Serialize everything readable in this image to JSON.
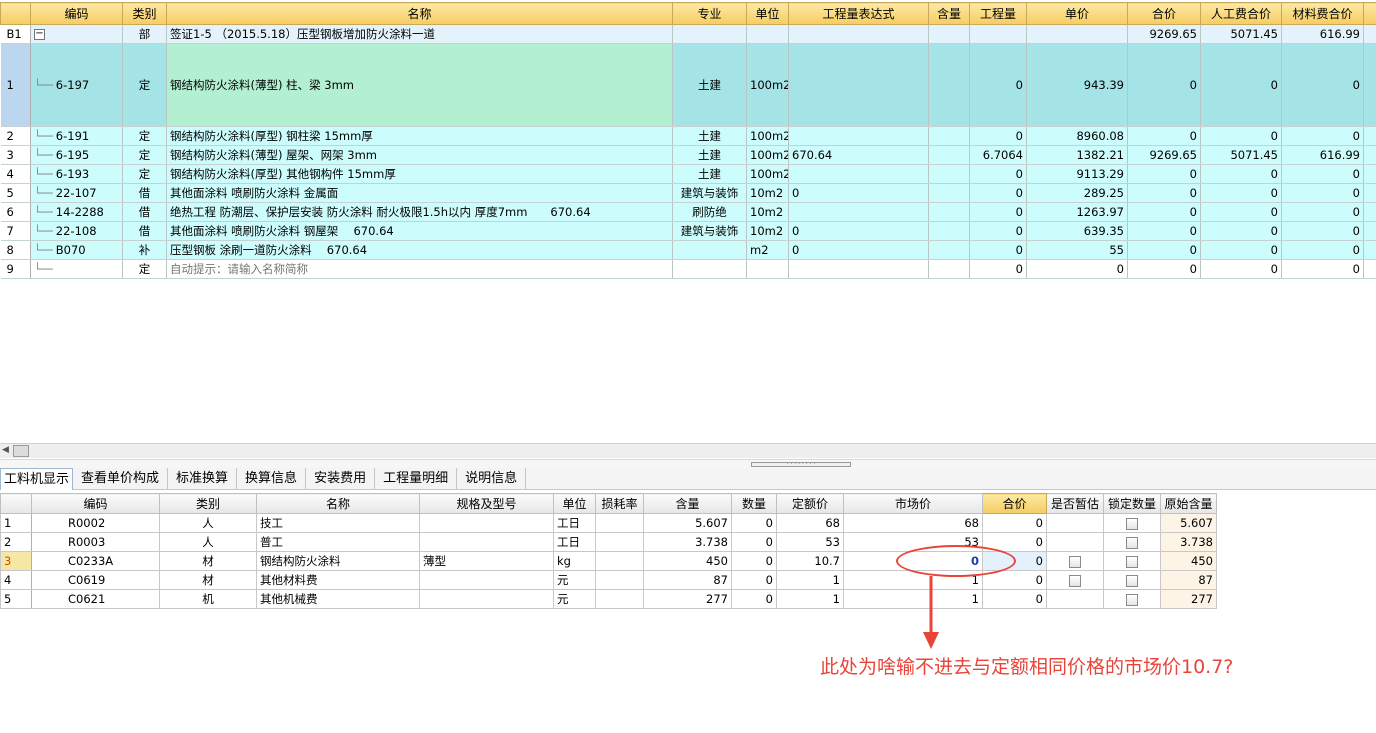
{
  "top_grid": {
    "headers": [
      "",
      "编码",
      "类别",
      "名称",
      "专业",
      "单位",
      "工程量表达式",
      "含量",
      "工程量",
      "单价",
      "合价",
      "人工费合价",
      "材料费合价",
      "材"
    ],
    "section_row": {
      "rownum": "B1",
      "collapse_symbol": "−",
      "type": "部",
      "name": "签证1-5 （2015.5.18）压型钢板增加防火涂料一道",
      "total": "9269.65",
      "labor_total": "5071.45",
      "material_total": "616.99"
    },
    "rows": [
      {
        "rownum": "1",
        "code": "6-197",
        "type": "定",
        "name": "钢结构防火涂料(薄型) 柱、梁 3mm",
        "major": "土建",
        "unit": "100m2",
        "expr": "",
        "qty": "0",
        "price": "943.39",
        "total": "0",
        "labor": "0",
        "material": "0"
      },
      {
        "rownum": "2",
        "code": "6-191",
        "type": "定",
        "name": "钢结构防火涂料(厚型) 钢柱梁 15mm厚",
        "major": "土建",
        "unit": "100m2",
        "expr": "",
        "qty": "0",
        "price": "8960.08",
        "total": "0",
        "labor": "0",
        "material": "0"
      },
      {
        "rownum": "3",
        "code": "6-195",
        "type": "定",
        "name": "钢结构防火涂料(薄型) 屋架、网架 3mm",
        "major": "土建",
        "unit": "100m2",
        "expr": "670.64",
        "qty": "6.7064",
        "price": "1382.21",
        "total": "9269.65",
        "labor": "5071.45",
        "material": "616.99"
      },
      {
        "rownum": "4",
        "code": "6-193",
        "type": "定",
        "name": "钢结构防火涂料(厚型) 其他钢构件 15mm厚",
        "major": "土建",
        "unit": "100m2",
        "expr": "",
        "qty": "0",
        "price": "9113.29",
        "total": "0",
        "labor": "0",
        "material": "0"
      },
      {
        "rownum": "5",
        "code": "22-107",
        "type": "借",
        "name": "其他面涂料 喷刷防火涂料 金属面",
        "major": "建筑与装饰",
        "unit": "10m2",
        "expr": "0",
        "qty": "0",
        "price": "289.25",
        "total": "0",
        "labor": "0",
        "material": "0"
      },
      {
        "rownum": "6",
        "code": "14-2288",
        "type": "借",
        "name": "绝热工程 防潮层、保护层安装 防火涂料 耐火极限1.5h以内 厚度7mm　　670.64",
        "major": "刷防绝",
        "unit": "10m2",
        "expr": "",
        "qty": "0",
        "price": "1263.97",
        "total": "0",
        "labor": "0",
        "material": "0"
      },
      {
        "rownum": "7",
        "code": "22-108",
        "type": "借",
        "name": "其他面涂料 喷刷防火涂料 钢屋架　 670.64",
        "major": "建筑与装饰",
        "unit": "10m2",
        "expr": "0",
        "qty": "0",
        "price": "639.35",
        "total": "0",
        "labor": "0",
        "material": "0"
      },
      {
        "rownum": "8",
        "code": "B070",
        "type": "补",
        "name": "压型钢板 涂刷一道防火涂料　 670.64",
        "major": "",
        "unit": "m2",
        "expr": "0",
        "qty": "0",
        "price": "55",
        "total": "0",
        "labor": "0",
        "material": "0"
      },
      {
        "rownum": "9",
        "code": "",
        "type": "定",
        "name": "自动提示：请输入名称简称",
        "major": "",
        "unit": "",
        "expr": "",
        "qty": "0",
        "price": "0",
        "total": "0",
        "labor": "0",
        "material": "0"
      }
    ]
  },
  "scrollbar": {
    "left_arrow": "◀"
  },
  "splitter": {
    "grip": "· · · · · · · ·"
  },
  "tabs": [
    "工料机显示",
    "查看单价构成",
    "标准换算",
    "换算信息",
    "安装费用",
    "工程量明细",
    "说明信息"
  ],
  "bottom_grid": {
    "headers": [
      "",
      "编码",
      "类别",
      "名称",
      "规格及型号",
      "单位",
      "损耗率",
      "含量",
      "数量",
      "定额价",
      "市场价",
      "合价",
      "是否暂估",
      "锁定数量",
      "原始含量"
    ],
    "rows": [
      {
        "rownum": "1",
        "code": "R0002",
        "type": "人",
        "name": "技工",
        "spec": "",
        "unit": "工日",
        "loss": "",
        "content": "5.607",
        "qty": "0",
        "quota_price": "68",
        "market_price": "68",
        "total": "0",
        "has_est": false,
        "orig": "5.607"
      },
      {
        "rownum": "2",
        "code": "R0003",
        "type": "人",
        "name": "普工",
        "spec": "",
        "unit": "工日",
        "loss": "",
        "content": "3.738",
        "qty": "0",
        "quota_price": "53",
        "market_price": "53",
        "total": "0",
        "has_est": false,
        "orig": "3.738"
      },
      {
        "rownum": "3",
        "code": "C0233A",
        "type": "材",
        "name": "钢结构防火涂料",
        "spec": "薄型",
        "unit": "kg",
        "loss": "",
        "content": "450",
        "qty": "0",
        "quota_price": "10.7",
        "market_price": "0",
        "total": "0",
        "has_est": true,
        "orig": "450"
      },
      {
        "rownum": "4",
        "code": "C0619",
        "type": "材",
        "name": "其他材料费",
        "spec": "",
        "unit": "元",
        "loss": "",
        "content": "87",
        "qty": "0",
        "quota_price": "1",
        "market_price": "1",
        "total": "0",
        "has_est": true,
        "orig": "87"
      },
      {
        "rownum": "5",
        "code": "C0621",
        "type": "机",
        "name": "其他机械费",
        "spec": "",
        "unit": "元",
        "loss": "",
        "content": "277",
        "qty": "0",
        "quota_price": "1",
        "market_price": "1",
        "total": "0",
        "has_est": false,
        "orig": "277"
      }
    ]
  },
  "annotation": {
    "text": "此处为啥输不进去与定额相同价格的市场价10.7?",
    "color": "#e8443a"
  },
  "colors": {
    "header_gold": "#f5cc62",
    "row_cyan": "#cdfcfd",
    "row_selected": "#a4e3e6",
    "name_selected": "#b3f0d2",
    "annotation_red": "#e8443a"
  }
}
